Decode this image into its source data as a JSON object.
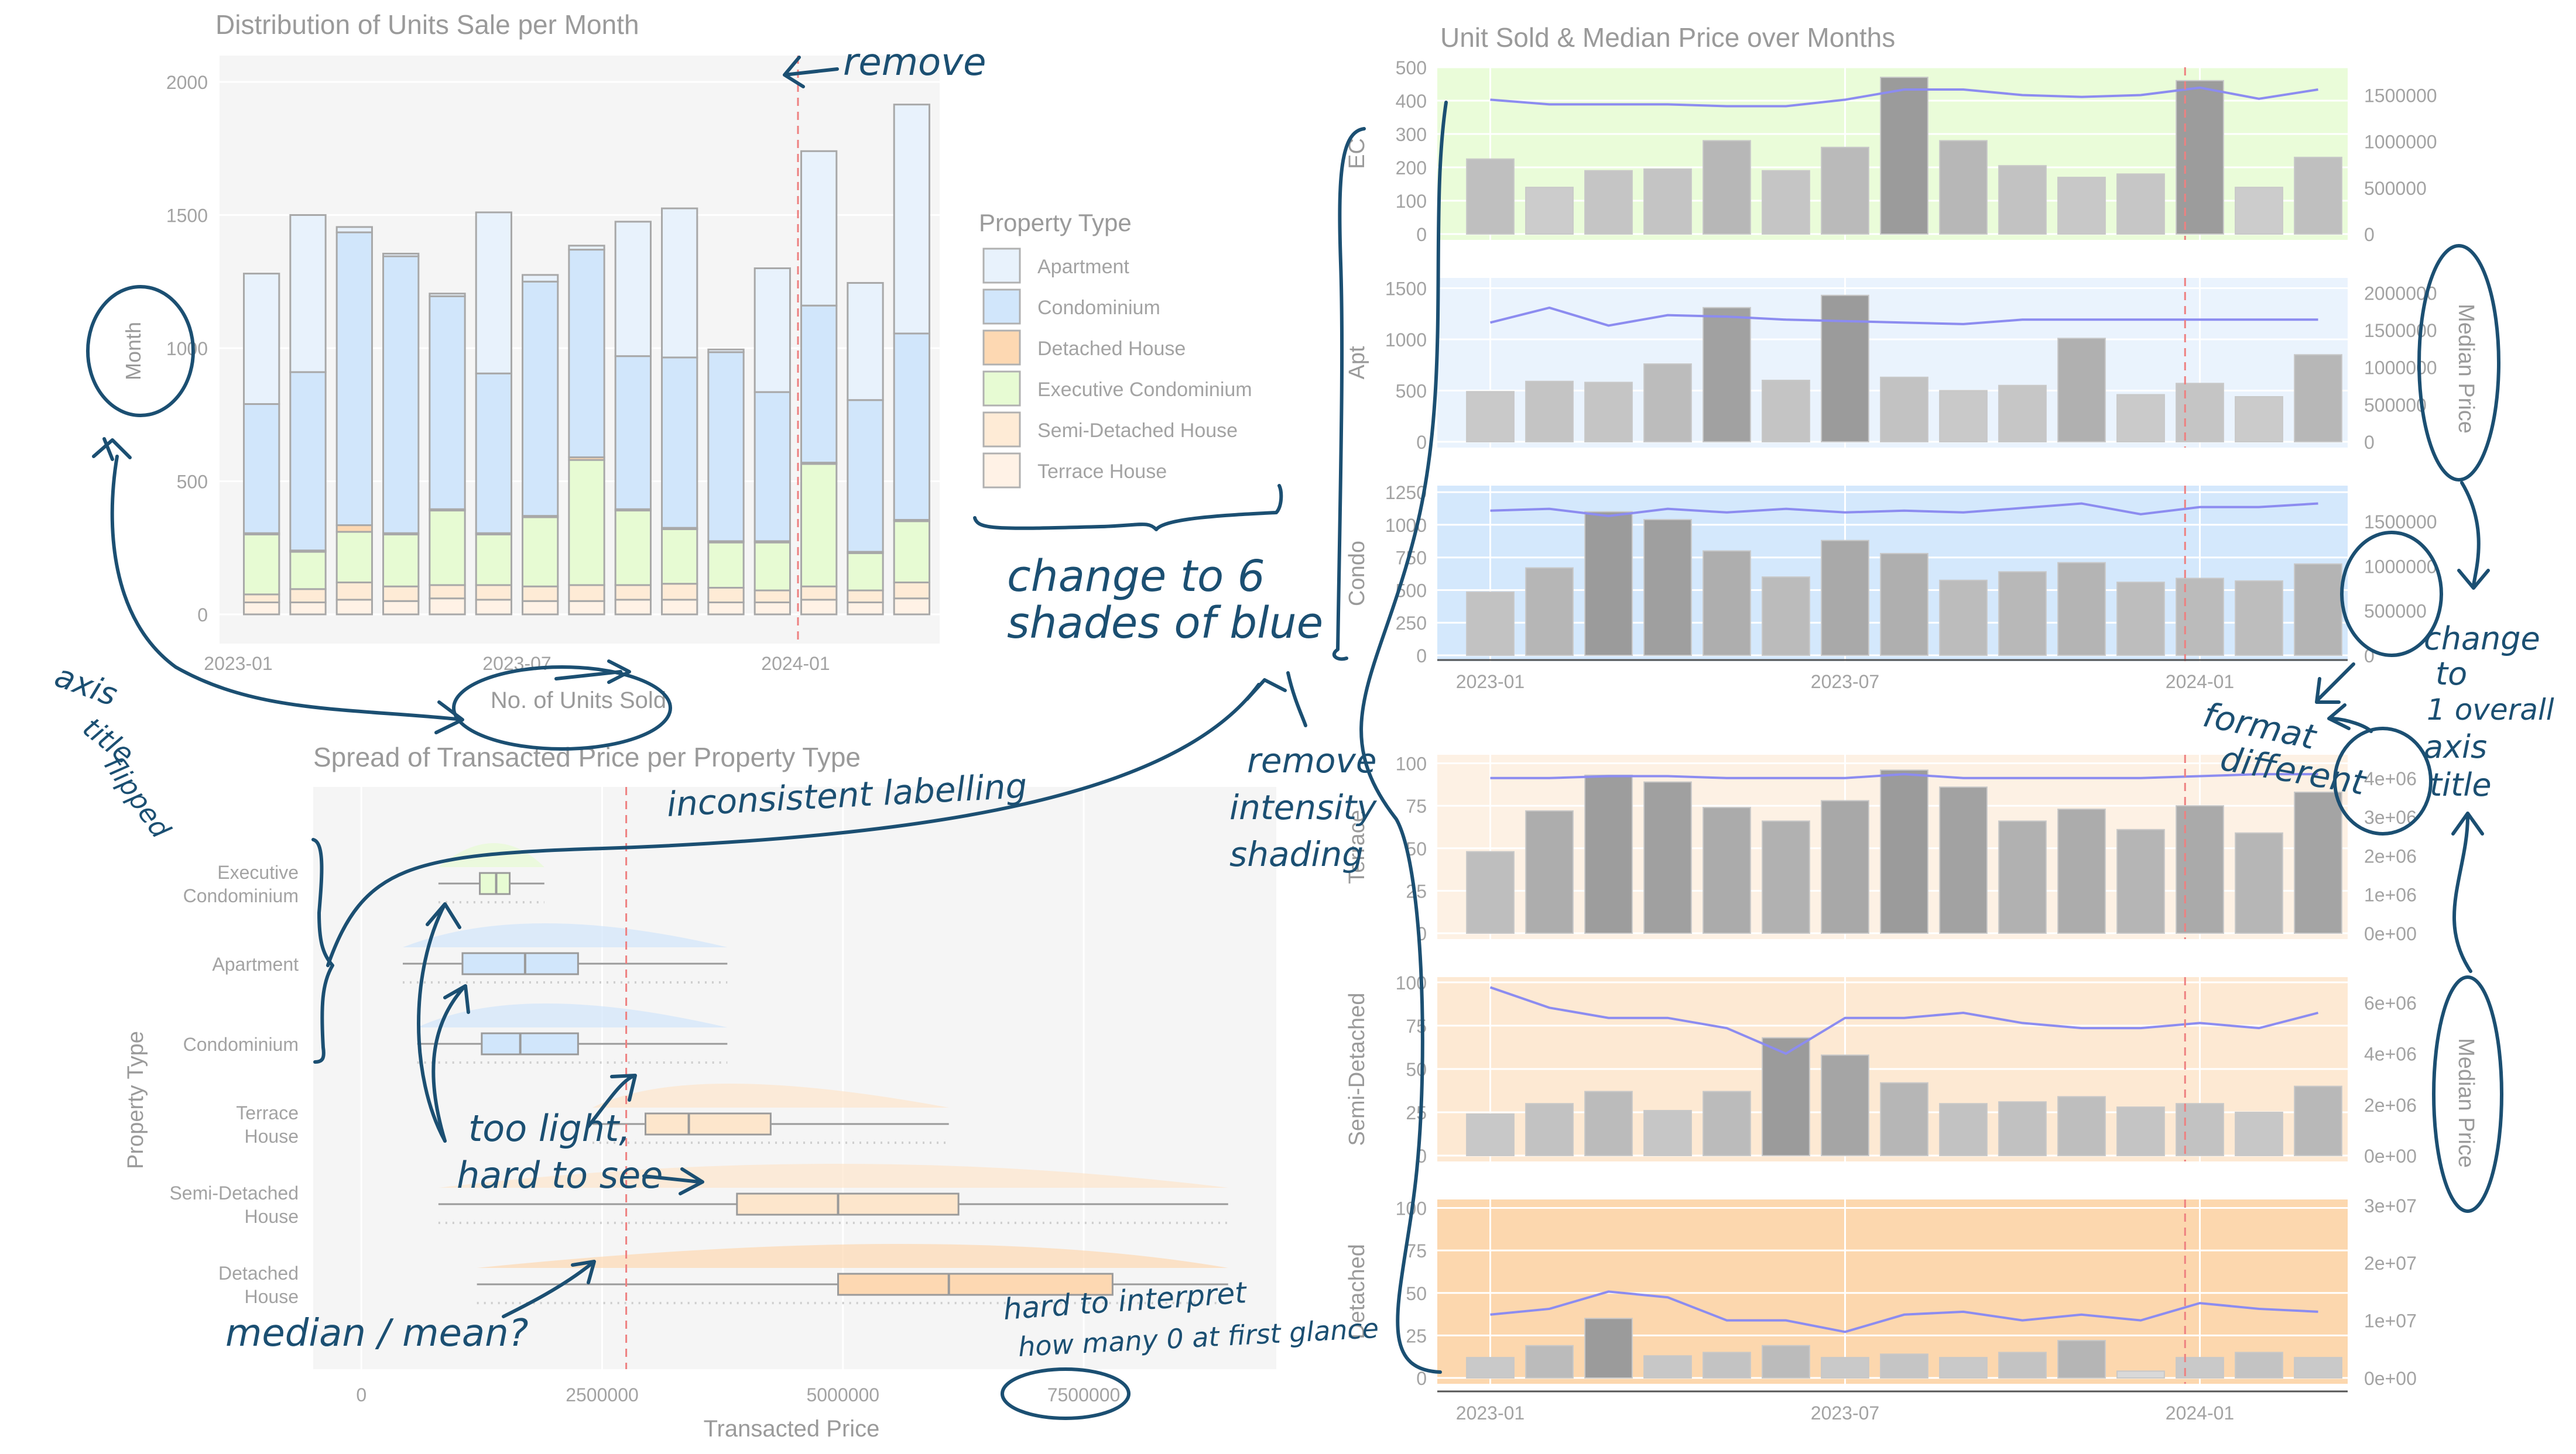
{
  "chart_data": [
    {
      "type": "bar",
      "title": "Distribution of Units Sale per Month",
      "xlabel": "No. of Units Sold",
      "ylabel": "Month",
      "ylim": [
        0,
        2000
      ],
      "yticks": [
        "0",
        "500",
        "1000",
        "1500",
        "2000"
      ],
      "xticks": [
        "2023-01",
        "2023-07",
        "2024-01"
      ],
      "reference_line_month_index": 12,
      "legend": {
        "title": "Property Type",
        "position": "right",
        "entries": [
          {
            "label": "Apartment",
            "color": "#e8f2fc"
          },
          {
            "label": "Condominium",
            "color": "#d1e6fb"
          },
          {
            "label": "Detached House",
            "color": "#fdd8b2"
          },
          {
            "label": "Executive Condominium",
            "color": "#e7fbd3"
          },
          {
            "label": "Semi-Detached House",
            "color": "#feebd6"
          },
          {
            "label": "Terrace House",
            "color": "#fff2e6"
          }
        ]
      },
      "months": [
        "2023-01",
        "2023-02",
        "2023-03",
        "2023-04",
        "2023-05",
        "2023-06",
        "2023-07",
        "2023-08",
        "2023-09",
        "2023-10",
        "2023-11",
        "2023-12",
        "2024-01",
        "2024-02",
        "2024-03"
      ],
      "series": [
        {
          "name": "Terrace House",
          "values": [
            45,
            45,
            55,
            50,
            60,
            55,
            50,
            50,
            55,
            55,
            45,
            45,
            55,
            45,
            60
          ]
        },
        {
          "name": "Semi-Detached House",
          "values": [
            30,
            50,
            65,
            55,
            50,
            55,
            55,
            60,
            55,
            60,
            55,
            45,
            50,
            45,
            60
          ]
        },
        {
          "name": "Executive Condominium",
          "values": [
            225,
            140,
            190,
            195,
            280,
            190,
            260,
            470,
            280,
            205,
            170,
            180,
            460,
            140,
            230
          ]
        },
        {
          "name": "Detached House",
          "values": [
            5,
            5,
            25,
            5,
            5,
            5,
            5,
            10,
            5,
            5,
            5,
            5,
            5,
            5,
            5
          ]
        },
        {
          "name": "Condominium",
          "values": [
            485,
            670,
            1100,
            1040,
            800,
            600,
            880,
            780,
            575,
            640,
            710,
            560,
            590,
            570,
            700
          ]
        },
        {
          "name": "Apartment",
          "values": [
            490,
            590,
            20,
            10,
            10,
            605,
            25,
            15,
            505,
            560,
            10,
            465,
            580,
            440,
            860
          ]
        }
      ]
    },
    {
      "type": "boxplot",
      "title": "Spread of Transacted Price per Property Type",
      "xlabel": "Transacted Price",
      "ylabel": "Property Type",
      "xlim": [
        -500000,
        9500000
      ],
      "xticks": [
        "0",
        "2500000",
        "5000000",
        "7500000"
      ],
      "reference_line_x": 2750000,
      "categories": [
        {
          "label_lines": [
            "Executive",
            "Condominium"
          ],
          "color": "#e7fbd3",
          "min": 800000,
          "q1": 1230000,
          "median": 1400000,
          "q3": 1540000,
          "max": 1900000
        },
        {
          "label_lines": [
            "Apartment"
          ],
          "color": "#d1e6fb",
          "min": 430000,
          "q1": 1050000,
          "median": 1700000,
          "q3": 2250000,
          "max": 3800000
        },
        {
          "label_lines": [
            "Condominium"
          ],
          "color": "#d1e6fb",
          "min": 580000,
          "q1": 1250000,
          "median": 1650000,
          "q3": 2250000,
          "max": 3800000
        },
        {
          "label_lines": [
            "Terrace",
            "House"
          ],
          "color": "#fde6cc",
          "min": 2400000,
          "q1": 2950000,
          "median": 3400000,
          "q3": 4250000,
          "max": 6100000
        },
        {
          "label_lines": [
            "Semi-Detached",
            "House"
          ],
          "color": "#fde6cc",
          "min": 800000,
          "q1": 3900000,
          "median": 4950000,
          "q3": 6200000,
          "max": 9000000
        },
        {
          "label_lines": [
            "Detached",
            "House"
          ],
          "color": "#fdd8b2",
          "min": 1200000,
          "q1": 4950000,
          "median": 6100000,
          "q3": 7800000,
          "max": 9000000
        }
      ]
    },
    {
      "type": "bar+line",
      "title": "Unit Sold & Median Price over Months",
      "secondary_axis_title": "Median Price",
      "xticks": [
        "2023-01",
        "2023-07",
        "2024-01"
      ],
      "reference_line_month_index": 12,
      "panels": [
        {
          "label": "EC",
          "bg": "#eafcd9",
          "ylim": [
            0,
            500
          ],
          "yticks": [
            "0",
            "100",
            "200",
            "300",
            "400",
            "500"
          ],
          "y2lim": [
            0,
            1800000
          ],
          "y2ticks": [
            "0",
            "500000",
            "1000000",
            "1500000"
          ],
          "units": [
            225,
            140,
            190,
            195,
            280,
            190,
            260,
            470,
            280,
            205,
            170,
            180,
            460,
            140,
            230
          ],
          "median_price": [
            1450000,
            1400000,
            1400000,
            1400000,
            1380000,
            1380000,
            1450000,
            1560000,
            1560000,
            1500000,
            1480000,
            1500000,
            1580000,
            1460000,
            1560000
          ]
        },
        {
          "label": "Apt",
          "bg": "#eaf3fd",
          "ylim": [
            0,
            1600
          ],
          "yticks": [
            "0",
            "500",
            "1000",
            "1500"
          ],
          "y2lim": [
            0,
            2200000
          ],
          "y2ticks": [
            "0",
            "500000",
            "1000000",
            "1500000",
            "2000000"
          ],
          "units": [
            490,
            590,
            580,
            760,
            1310,
            600,
            1430,
            630,
            500,
            550,
            1010,
            460,
            570,
            440,
            850
          ],
          "median_price": [
            1600000,
            1800000,
            1560000,
            1700000,
            1680000,
            1640000,
            1620000,
            1600000,
            1580000,
            1640000,
            1640000,
            1640000,
            1640000,
            1640000,
            1640000
          ]
        },
        {
          "label": "Condo",
          "bg": "#d4e8fc",
          "ylim": [
            0,
            1300
          ],
          "yticks": [
            "0",
            "250",
            "500",
            "750",
            "1000",
            "1250"
          ],
          "y2lim": [
            0,
            1900000
          ],
          "y2ticks": [
            "0",
            "500000",
            "1000000",
            "1500000"
          ],
          "units": [
            485,
            670,
            1100,
            1040,
            800,
            600,
            880,
            780,
            575,
            640,
            710,
            560,
            590,
            570,
            700
          ],
          "median_price": [
            1620000,
            1640000,
            1560000,
            1640000,
            1600000,
            1640000,
            1600000,
            1620000,
            1600000,
            1650000,
            1700000,
            1580000,
            1660000,
            1660000,
            1700000
          ]
        },
        {
          "label": "Terrace",
          "bg": "#fdf1e4",
          "ylim": [
            0,
            105
          ],
          "yticks": [
            "0",
            "25",
            "50",
            "75",
            "100"
          ],
          "y2lim": [
            0,
            4600000
          ],
          "y2ticks": [
            "0e+00",
            "1e+06",
            "2e+06",
            "3e+06",
            "4e+06"
          ],
          "units": [
            48,
            72,
            93,
            89,
            74,
            66,
            78,
            96,
            86,
            66,
            73,
            61,
            75,
            59,
            83
          ],
          "median_price": [
            4000000,
            4000000,
            4050000,
            4050000,
            4000000,
            4000000,
            4000000,
            4100000,
            4000000,
            4000000,
            4000000,
            4000000,
            4050000,
            4100000,
            4100000
          ]
        },
        {
          "label": "Semi-Detached",
          "bg": "#fde9d3",
          "ylim": [
            0,
            103
          ],
          "yticks": [
            "0",
            "25",
            "50",
            "75",
            "100"
          ],
          "y2lim": [
            0,
            7000000
          ],
          "y2ticks": [
            "0e+00",
            "2e+06",
            "4e+06",
            "6e+06"
          ],
          "units": [
            24,
            30,
            37,
            26,
            37,
            68,
            58,
            42,
            30,
            31,
            34,
            28,
            30,
            25,
            40
          ],
          "median_price": [
            6600000,
            5800000,
            5400000,
            5400000,
            5000000,
            4000000,
            5400000,
            5400000,
            5600000,
            5200000,
            5000000,
            5000000,
            5200000,
            5000000,
            5600000
          ]
        },
        {
          "label": "Detached",
          "bg": "#fcd7ae",
          "ylim": [
            0,
            105
          ],
          "yticks": [
            "0",
            "25",
            "50",
            "75",
            "100"
          ],
          "y2lim": [
            0,
            31000000
          ],
          "y2ticks": [
            "0e+00",
            "1e+07",
            "2e+07",
            "3e+07"
          ],
          "units": [
            12,
            19,
            35,
            13,
            15,
            19,
            12,
            14,
            12,
            15,
            22,
            4,
            12,
            15,
            12
          ],
          "median_price": [
            11000000,
            12000000,
            15000000,
            14000000,
            10000000,
            10000000,
            8000000,
            11000000,
            11500000,
            10000000,
            11000000,
            10000000,
            13000000,
            12000000,
            11500000
          ]
        }
      ]
    }
  ],
  "annotations": {
    "remove": "remove",
    "axis_title_flipped_l1": "axis",
    "axis_title_flipped_l2": "title",
    "axis_title_flipped_l3": "flipped",
    "change_to_6_l1": "change to 6",
    "change_to_6_l2": "shades of blue",
    "inconsistent": "inconsistent labelling",
    "remove_intensity_l1": "remove",
    "remove_intensity_l2": "intensity",
    "remove_intensity_l3": "shading",
    "too_light_l1": "too light,",
    "too_light_l2": "hard to see",
    "median_mean": "median / mean?",
    "hard_to_interpret_l1": "hard to interpret",
    "hard_to_interpret_l2": "how many 0 at first glance",
    "format_different_l1": "format",
    "format_different_l2": "different",
    "change_to_1_axis_l1": "change",
    "change_to_1_axis_l2": "to",
    "change_to_1_axis_l3": "1 overall",
    "change_to_1_axis_l4": "axis",
    "change_to_1_axis_l5": "title"
  }
}
